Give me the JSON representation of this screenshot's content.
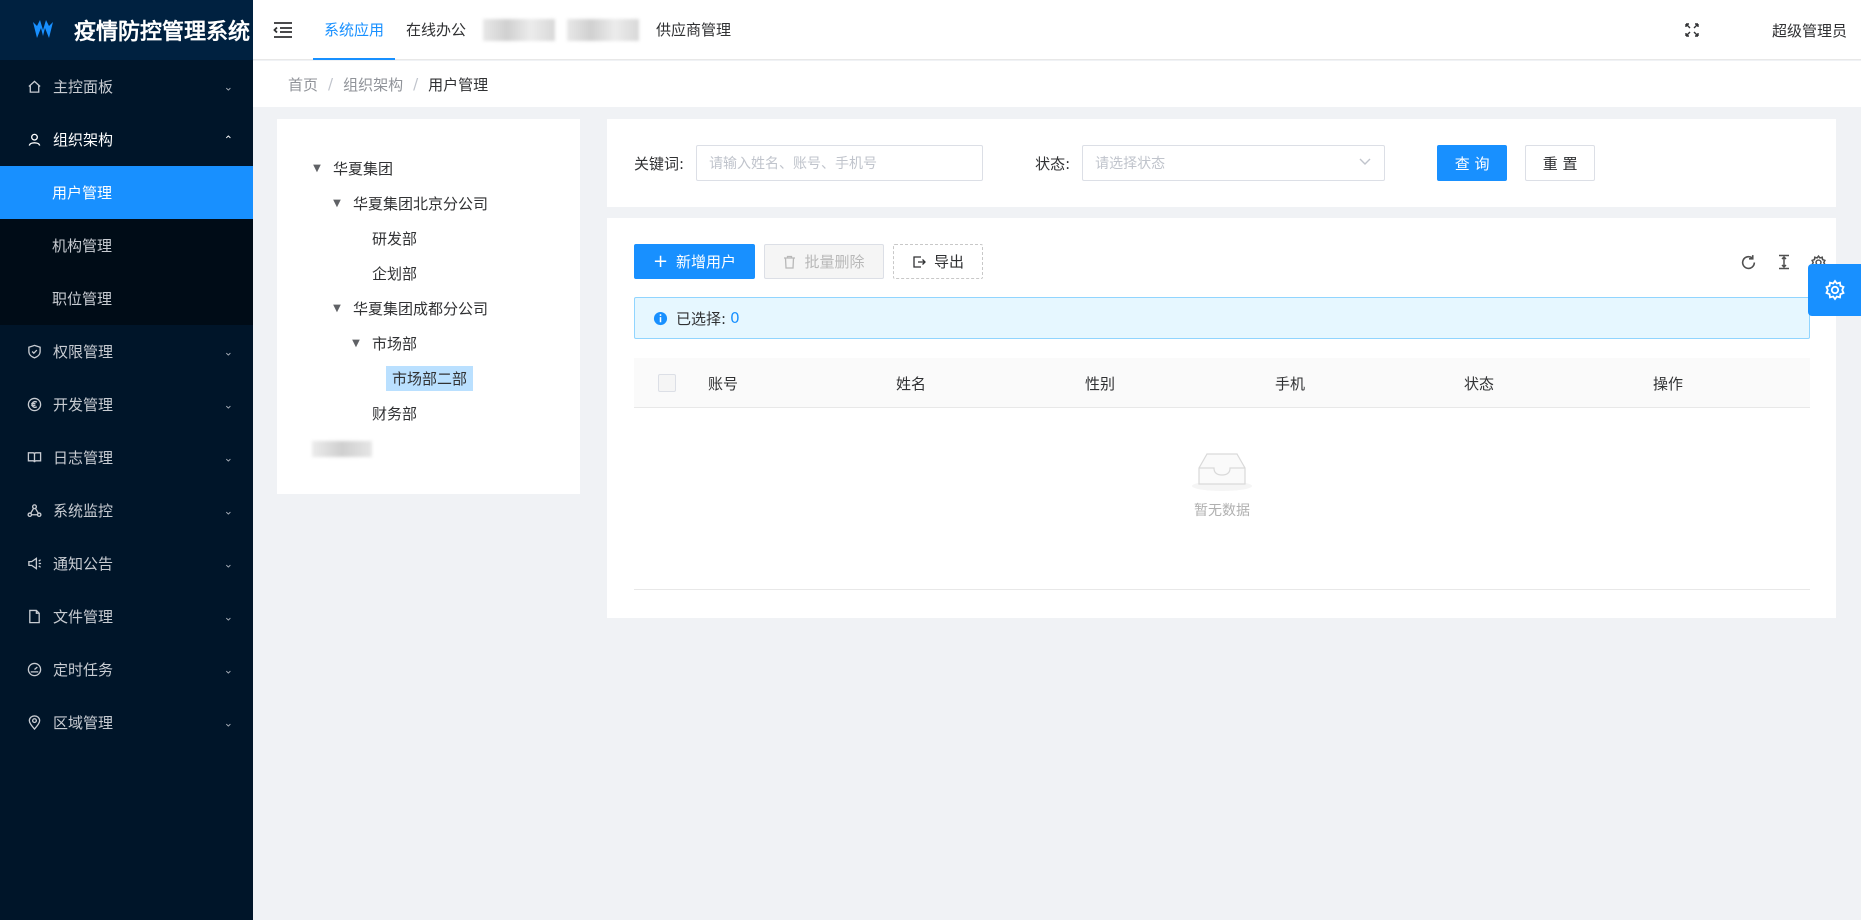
{
  "app": {
    "title": "疫情防控管理系统"
  },
  "sidebar": {
    "items": [
      {
        "label": "主控面板",
        "icon": "home-icon"
      },
      {
        "label": "组织架构",
        "icon": "user-icon",
        "open": true,
        "children": [
          {
            "label": "用户管理",
            "active": true
          },
          {
            "label": "机构管理"
          },
          {
            "label": "职位管理"
          }
        ]
      },
      {
        "label": "权限管理",
        "icon": "shield-icon"
      },
      {
        "label": "开发管理",
        "icon": "euro-icon"
      },
      {
        "label": "日志管理",
        "icon": "book-icon"
      },
      {
        "label": "系统监控",
        "icon": "cluster-icon"
      },
      {
        "label": "通知公告",
        "icon": "speaker-icon"
      },
      {
        "label": "文件管理",
        "icon": "file-icon"
      },
      {
        "label": "定时任务",
        "icon": "dashboard-icon"
      },
      {
        "label": "区域管理",
        "icon": "location-icon"
      }
    ]
  },
  "topbar": {
    "tabs": [
      {
        "label": "系统应用",
        "active": true
      },
      {
        "label": "在线办公"
      },
      {
        "label": "供应商管理"
      }
    ],
    "user": "超级管理员"
  },
  "breadcrumb": [
    "首页",
    "组织架构",
    "用户管理"
  ],
  "tree": {
    "root": "华夏集团",
    "beijing": "华夏集团北京分公司",
    "rd": "研发部",
    "planning": "企划部",
    "chengdu": "华夏集团成都分公司",
    "market": "市场部",
    "market2": "市场部二部",
    "finance": "财务部"
  },
  "search": {
    "keyword_label": "关键词:",
    "keyword_placeholder": "请输入姓名、账号、手机号",
    "status_label": "状态:",
    "status_placeholder": "请选择状态",
    "query_label": "查 询",
    "reset_label": "重 置"
  },
  "toolbar": {
    "add_label": "新增用户",
    "batch_delete_label": "批量删除",
    "export_label": "导出"
  },
  "alert": {
    "label": "已选择:",
    "count": "0"
  },
  "table": {
    "columns": [
      "账号",
      "姓名",
      "性别",
      "手机",
      "状态",
      "操作"
    ],
    "empty_text": "暂无数据"
  },
  "colors": {
    "primary": "#1890ff",
    "sidebar": "#001529"
  }
}
